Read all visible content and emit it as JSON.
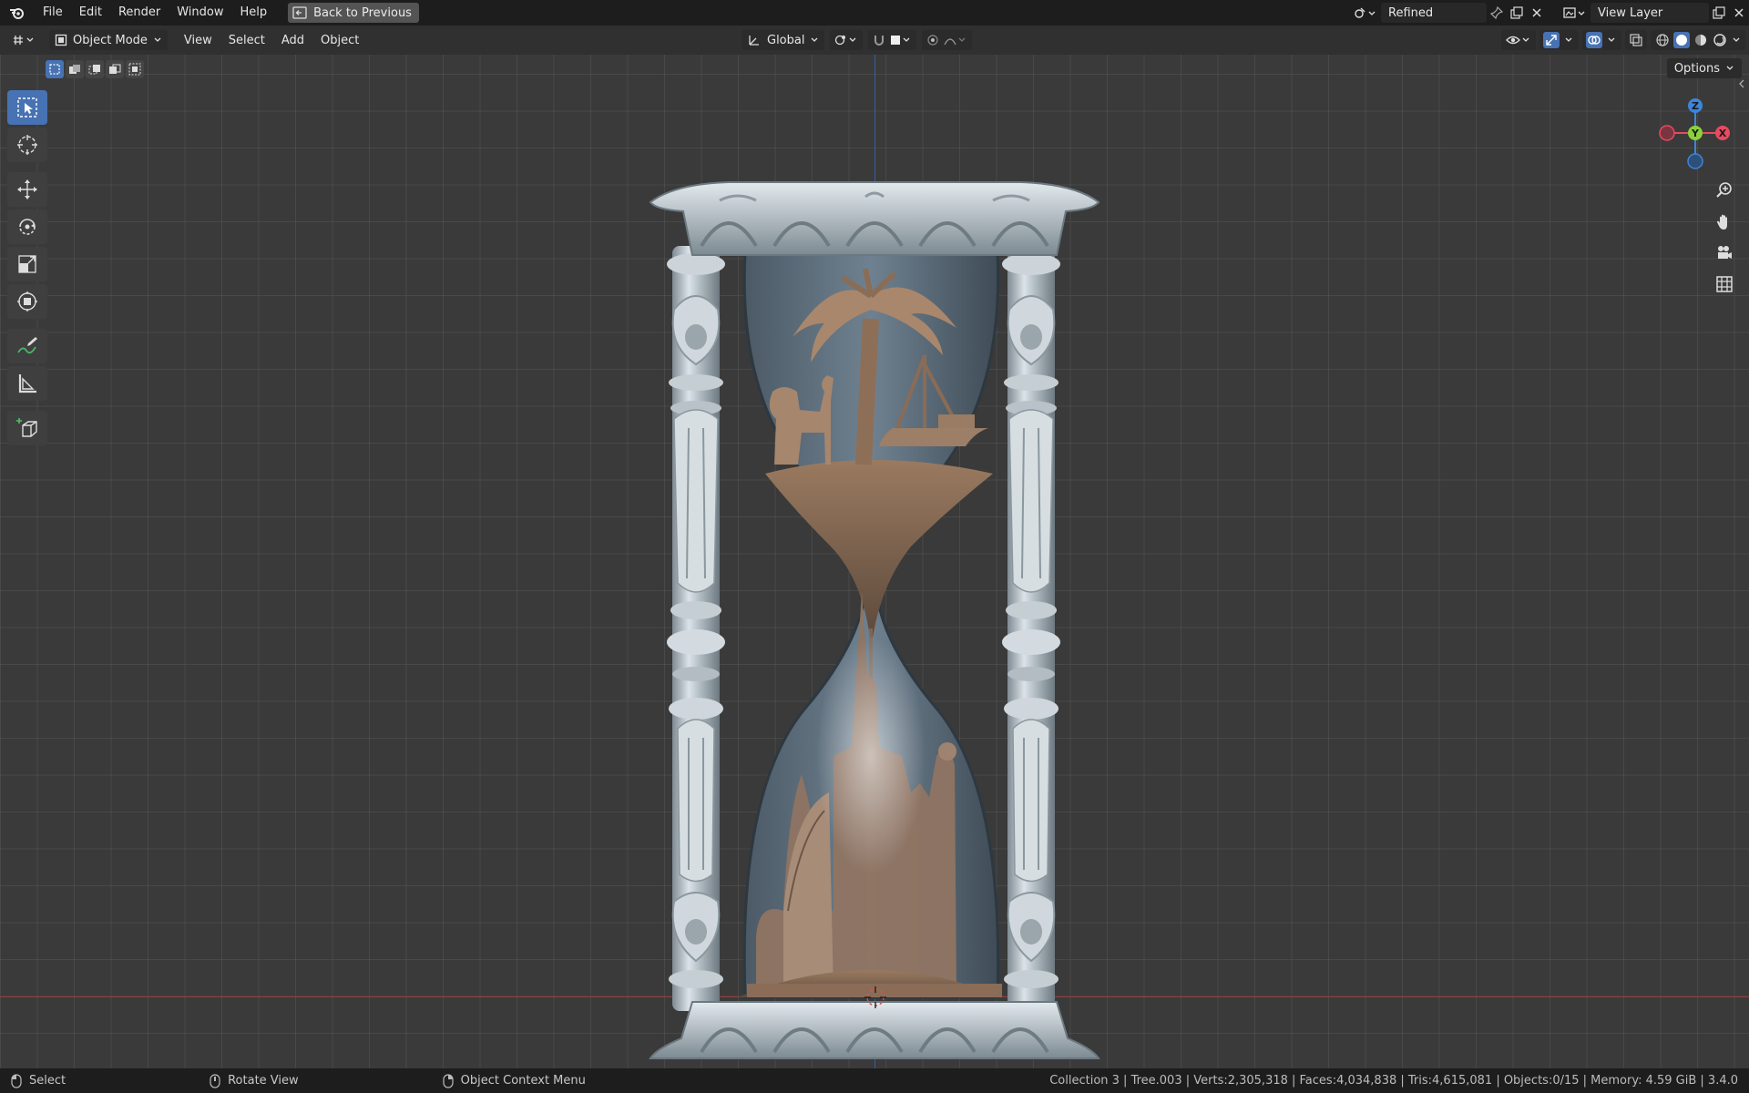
{
  "menubar": {
    "items": [
      "File",
      "Edit",
      "Render",
      "Window",
      "Help"
    ],
    "back_button": "Back to Previous",
    "scene_name": "Refined",
    "view_layer": "View Layer"
  },
  "viewport_header": {
    "mode": "Object Mode",
    "menus": [
      "View",
      "Select",
      "Add",
      "Object"
    ],
    "transform_orientation": "Global",
    "options_label": "Options"
  },
  "toolbar": {
    "tools": [
      {
        "name": "select-box-tool",
        "icon": "select-box-icon",
        "active": true
      },
      {
        "name": "cursor-tool",
        "icon": "cursor-icon",
        "active": false
      },
      {
        "name": "move-tool",
        "icon": "move-icon",
        "active": false
      },
      {
        "name": "rotate-tool",
        "icon": "rotate-icon",
        "active": false
      },
      {
        "name": "scale-tool",
        "icon": "scale-icon",
        "active": false
      },
      {
        "name": "transform-tool",
        "icon": "transform-icon",
        "active": false
      },
      {
        "name": "annotate-tool",
        "icon": "annotate-icon",
        "active": false
      },
      {
        "name": "measure-tool",
        "icon": "measure-icon",
        "active": false
      },
      {
        "name": "add-cube-tool",
        "icon": "add-cube-icon",
        "active": false
      }
    ]
  },
  "gizmo": {
    "x_label": "X",
    "y_label": "Y",
    "z_label": "Z"
  },
  "statusbar": {
    "left": [
      {
        "label": "Select",
        "icon": "mouse-left-icon"
      },
      {
        "label": "Rotate View",
        "icon": "mouse-middle-icon"
      },
      {
        "label": "Object Context Menu",
        "icon": "mouse-right-icon"
      }
    ],
    "stats": "Collection 3 | Tree.003 | Verts:2,305,318 | Faces:4,034,838 | Tris:4,615,081 | Objects:0/15 | Memory: 4.59 GiB | 3.4.0"
  },
  "colors": {
    "accent": "#4772b3",
    "axis_x": "#e84a5f",
    "axis_y": "#8bd13a",
    "axis_z": "#3d85d9"
  }
}
